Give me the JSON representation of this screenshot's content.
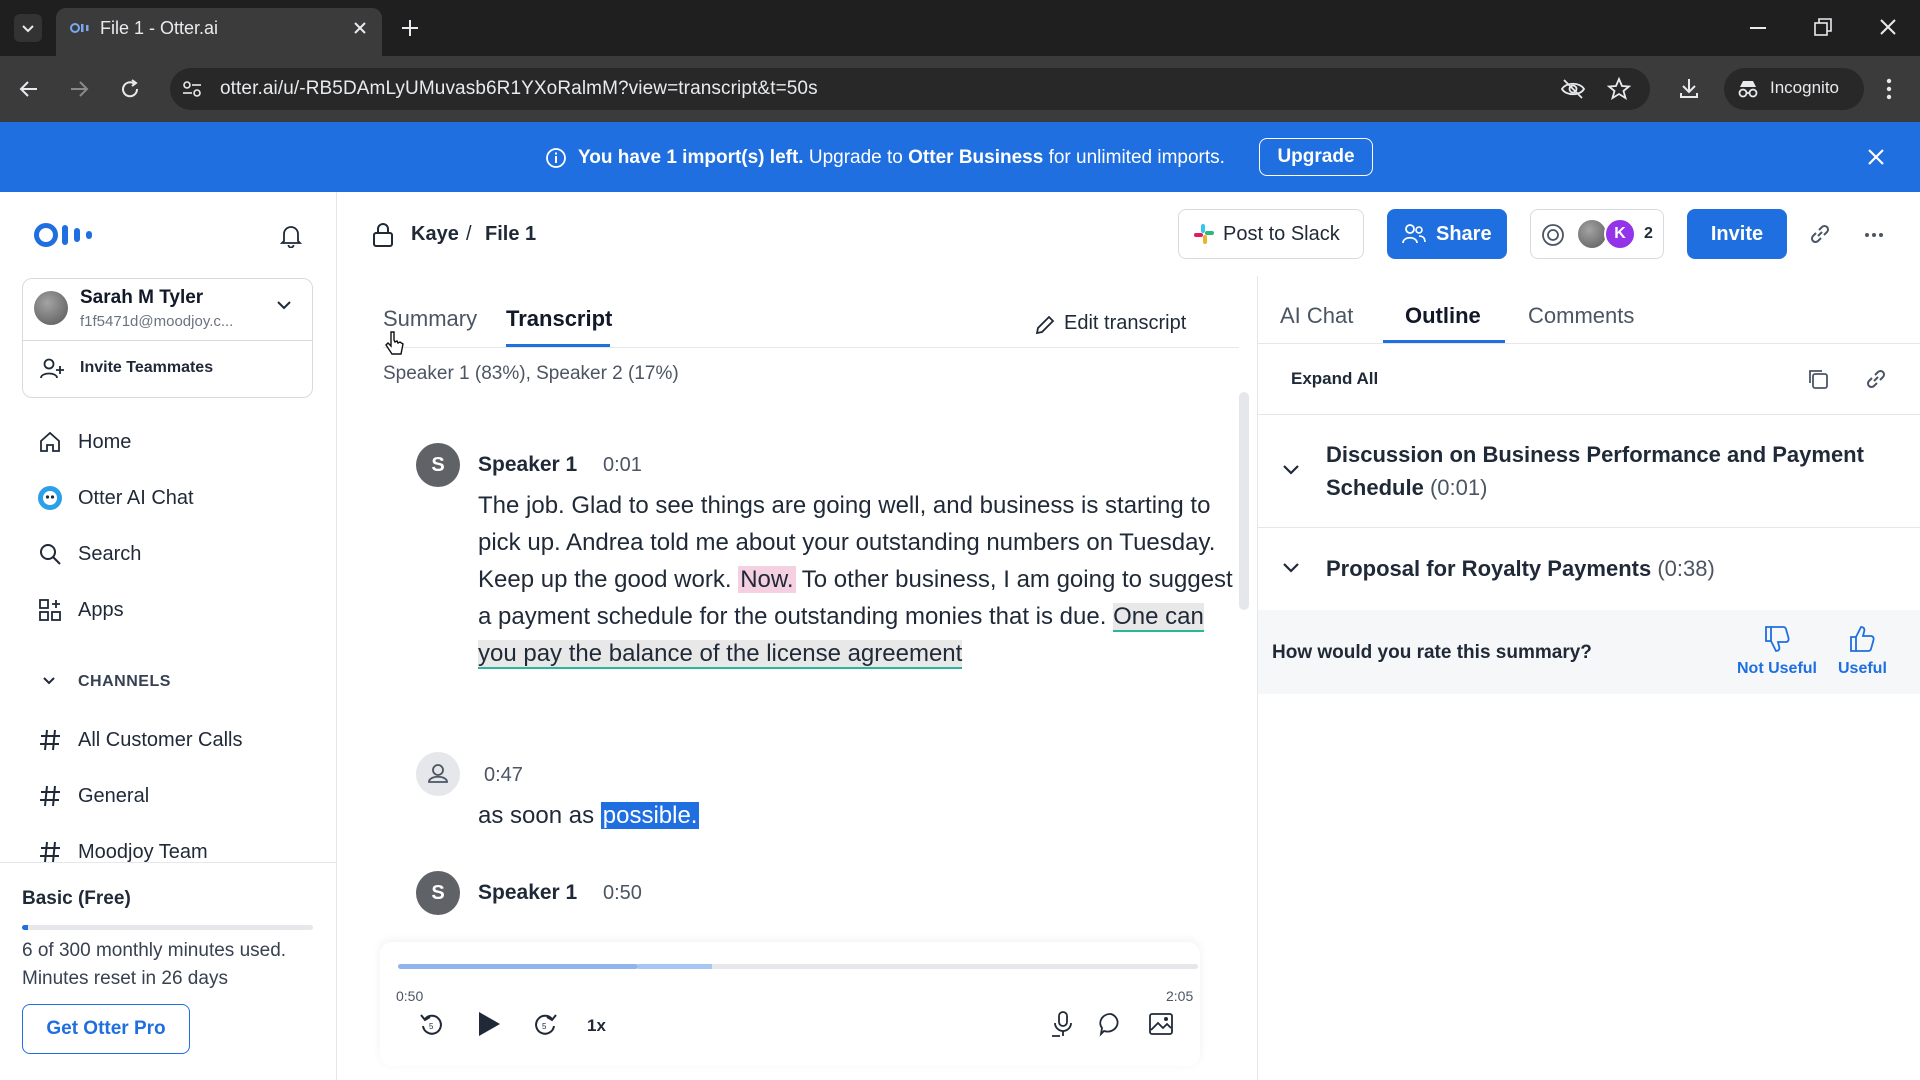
{
  "browser": {
    "tab_title": "File 1 - Otter.ai",
    "url": "otter.ai/u/-RB5DAmLyUMuvasb6R1YXoRalmM?view=transcript&t=50s",
    "incognito_label": "Incognito"
  },
  "banner": {
    "text_bold_1": "You have 1 import(s) left.",
    "text_bold_2": " Upgrade to ",
    "text_brand": "Otter Business",
    "text_rest": " for unlimited imports.",
    "upgrade_label": "Upgrade",
    "color": "#1f6fe0"
  },
  "sidebar": {
    "user": {
      "name": "Sarah M Tyler",
      "email": "f1f5471d@moodjoy.c..."
    },
    "invite_label": "Invite Teammates",
    "nav": [
      {
        "label": "Home",
        "icon": "home-icon"
      },
      {
        "label": "Otter AI Chat",
        "icon": "otter-chat-icon"
      },
      {
        "label": "Search",
        "icon": "search-icon"
      },
      {
        "label": "Apps",
        "icon": "apps-icon"
      }
    ],
    "channels_title": "CHANNELS",
    "channels": [
      {
        "label": "All Customer Calls"
      },
      {
        "label": "General"
      },
      {
        "label": "Moodjoy Team"
      }
    ],
    "plan": {
      "name": "Basic (Free)",
      "usage": "6 of 300 monthly minutes used.",
      "reset": "Minutes reset in 26 days",
      "used_fraction": 0.02,
      "cta": "Get Otter Pro"
    }
  },
  "header": {
    "breadcrumb": {
      "folder": "Kaye",
      "separator": "/",
      "file": "File 1"
    },
    "post_slack_label": "Post to Slack",
    "share_label": "Share",
    "collaborator_initial": "K",
    "collaborator_count": "2",
    "invite_label": "Invite"
  },
  "transcript_panel": {
    "tabs": {
      "summary": "Summary",
      "transcript": "Transcript"
    },
    "edit_label": "Edit transcript",
    "speaker_stats": "Speaker 1 (83%), Speaker 2 (17%)",
    "entries": [
      {
        "avatar": "S",
        "speaker": "Speaker 1",
        "time": "0:01",
        "text_1": "The job. Glad to see things are going well, and business is starting to pick up. Andrea told me about your outstanding numbers on Tuesday. Keep up the good work. ",
        "text_hl_pink": "Now.",
        "text_2": " To other business, I am going to suggest a payment schedule for the outstanding monies that is due. ",
        "text_hl_gray": "One can you pay the balance of the license agreement"
      },
      {
        "time": "0:47",
        "text_1": "as soon as ",
        "text_hl_blue": "possible."
      },
      {
        "avatar": "S",
        "speaker": "Speaker 1",
        "time": "0:50"
      }
    ],
    "player": {
      "current": "0:50",
      "total": "2:05",
      "speed": "1x",
      "played_fraction": 0.3
    }
  },
  "right_panel": {
    "tabs": {
      "ai_chat": "AI Chat",
      "outline": "Outline",
      "comments": "Comments"
    },
    "expand_all": "Expand All",
    "outline": [
      {
        "title": "Discussion on Business Performance and Payment Schedule",
        "time": "(0:01)"
      },
      {
        "title": "Proposal for Royalty Payments",
        "time": "(0:38)"
      }
    ],
    "rating": {
      "question": "How would you rate this summary?",
      "not_useful": "Not Useful",
      "useful": "Useful"
    }
  }
}
